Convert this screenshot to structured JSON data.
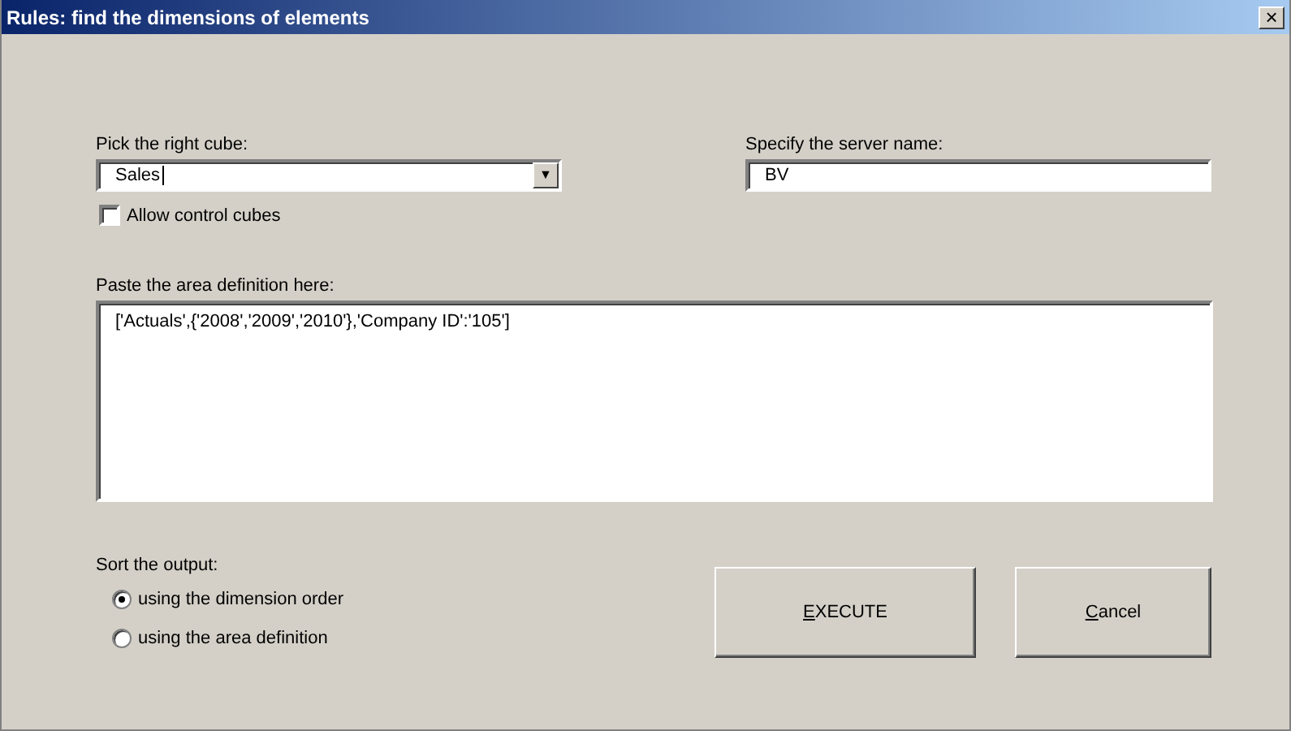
{
  "window": {
    "title": "Rules: find the dimensions of elements",
    "close": "×"
  },
  "cube": {
    "label": "Pick the right cube:",
    "value": "Sales",
    "arrow": "▼"
  },
  "server": {
    "label": "Specify the server name:",
    "value": "BV"
  },
  "allow_control_cubes": {
    "label": "Allow control cubes",
    "checked": false
  },
  "area": {
    "label": "Paste the area definition here:",
    "value": "['Actuals',{'2008','2009','2010'},'Company ID':'105']"
  },
  "sort": {
    "label": "Sort the output:",
    "options": [
      {
        "label": "using the dimension order",
        "selected": true
      },
      {
        "label": "using the area definition",
        "selected": false
      }
    ]
  },
  "buttons": [
    {
      "mnemonic": "E",
      "label_rest": "XECUTE"
    },
    {
      "mnemonic": "C",
      "label_rest": "ancel"
    }
  ]
}
